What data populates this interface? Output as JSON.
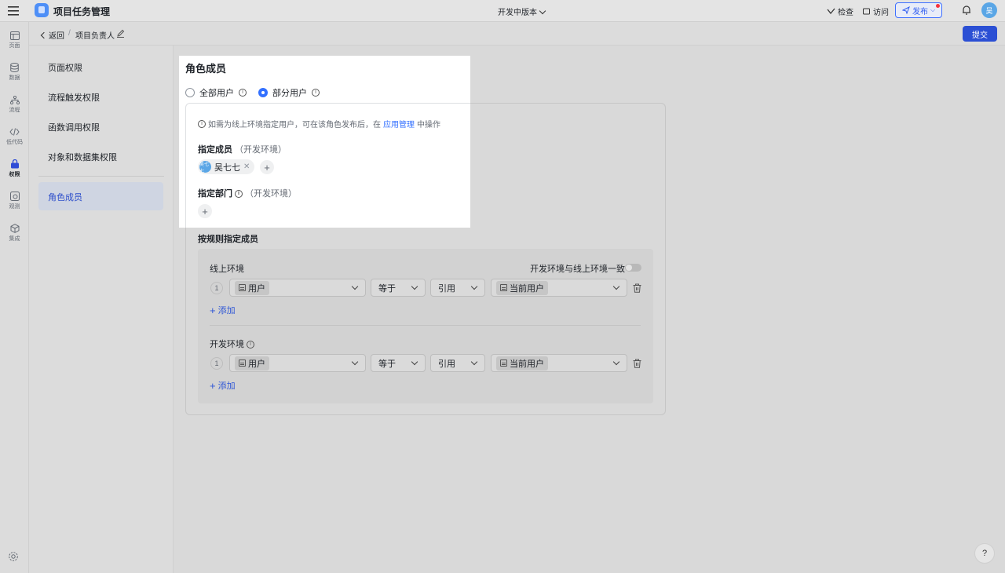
{
  "app": {
    "title": "项目任务管理",
    "version_label": "开发中版本"
  },
  "toolbar": {
    "check_label": "检查",
    "visit_label": "访问",
    "publish_label": "发布",
    "avatar_text": "吴"
  },
  "rail": {
    "items": [
      {
        "label": "页面",
        "icon": "page-icon"
      },
      {
        "label": "数据",
        "icon": "database-icon"
      },
      {
        "label": "流程",
        "icon": "flow-icon"
      },
      {
        "label": "低代码",
        "icon": "code-icon"
      },
      {
        "label": "权限",
        "icon": "lock-icon"
      },
      {
        "label": "观测",
        "icon": "monitor-icon"
      },
      {
        "label": "集成",
        "icon": "integration-icon"
      }
    ]
  },
  "breadcrumb": {
    "back_label": "返回",
    "separator": "/",
    "role_name": "项目负责人"
  },
  "actions": {
    "submit_label": "提交"
  },
  "sidenav": {
    "items": [
      "页面权限",
      "流程触发权限",
      "函数调用权限",
      "对象和数据集权限"
    ],
    "active": "角色成员"
  },
  "panel": {
    "title": "角色成员",
    "radio_all": "全部用户",
    "radio_partial": "部分用户",
    "hint_prefix": "如需为线上环境指定用户，可在该角色发布后，在",
    "hint_link": "应用管理",
    "hint_suffix": "中操作",
    "members_label": "指定成员",
    "members_env": "（开发环境）",
    "member_name": "吴七七",
    "member_avatar": "吴七七",
    "dept_label": "指定部门",
    "dept_env": "（开发环境）"
  },
  "rules": {
    "title": "按规则指定成员",
    "sync_label": "开发环境与线上环境一致",
    "online": {
      "label": "线上环境",
      "index": "1",
      "field": "用户",
      "operator": "等于",
      "ref": "引用",
      "value": "当前用户",
      "add_label": "添加"
    },
    "dev": {
      "label": "开发环境",
      "index": "1",
      "field": "用户",
      "operator": "等于",
      "ref": "引用",
      "value": "当前用户",
      "add_label": "添加"
    }
  },
  "help": {
    "label": "?"
  }
}
